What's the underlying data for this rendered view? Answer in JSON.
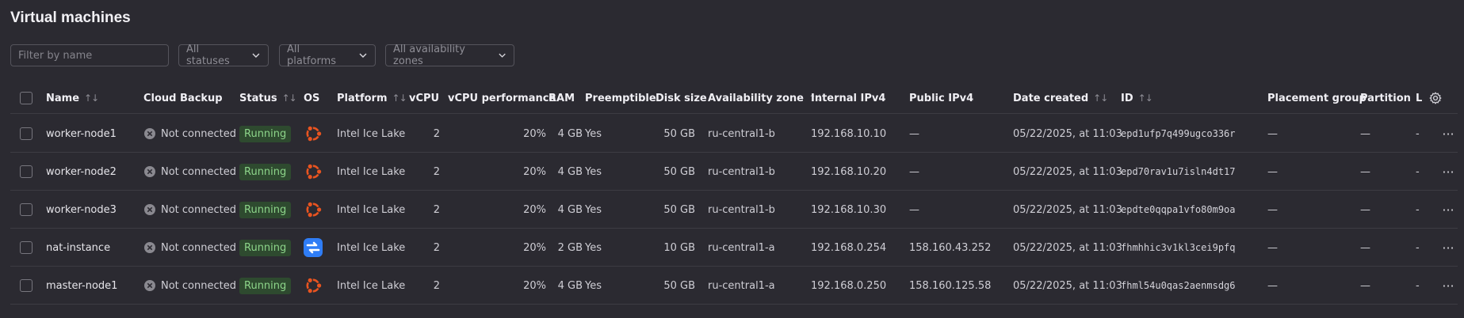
{
  "page": {
    "title": "Virtual machines"
  },
  "filters": {
    "name_placeholder": "Filter by name",
    "statuses": "All statuses",
    "platforms": "All platforms",
    "zones": "All availability zones"
  },
  "columns": {
    "name": "Name",
    "cloud_backup": "Cloud Backup",
    "status": "Status",
    "os": "OS",
    "platform": "Platform",
    "vcpu": "vCPU",
    "vcpu_perf": "vCPU performance",
    "ram": "RAM",
    "preemptible": "Preemptible",
    "disk": "Disk size",
    "zone": "Availability zone",
    "internal_ip": "Internal IPv4",
    "public_ip": "Public IPv4",
    "date_created": "Date created",
    "id": "ID",
    "placement": "Placement group",
    "partition": "Partition",
    "truncated": "L",
    "sort_glyph": "↑↓"
  },
  "rows": [
    {
      "name": "worker-node1",
      "backup": "Not connected",
      "status": "Running",
      "os": "ubuntu-icon",
      "platform": "Intel Ice Lake",
      "vcpu": "2",
      "perf": "20%",
      "ram": "4 GB",
      "preemptible": "Yes",
      "disk": "50 GB",
      "zone": "ru-central1-b",
      "internal_ip": "192.168.10.10",
      "public_ip": "—",
      "date": "05/22/2025, at 11:03",
      "id": "epd1ufp7q499ugco336r",
      "placement": "—",
      "partition": "—",
      "last": "-",
      "more": "···"
    },
    {
      "name": "worker-node2",
      "backup": "Not connected",
      "status": "Running",
      "os": "ubuntu-icon",
      "platform": "Intel Ice Lake",
      "vcpu": "2",
      "perf": "20%",
      "ram": "4 GB",
      "preemptible": "Yes",
      "disk": "50 GB",
      "zone": "ru-central1-b",
      "internal_ip": "192.168.10.20",
      "public_ip": "—",
      "date": "05/22/2025, at 11:03",
      "id": "epd70rav1u7isln4dt17",
      "placement": "—",
      "partition": "—",
      "last": "-",
      "more": "···"
    },
    {
      "name": "worker-node3",
      "backup": "Not connected",
      "status": "Running",
      "os": "ubuntu-icon",
      "platform": "Intel Ice Lake",
      "vcpu": "2",
      "perf": "20%",
      "ram": "4 GB",
      "preemptible": "Yes",
      "disk": "50 GB",
      "zone": "ru-central1-b",
      "internal_ip": "192.168.10.30",
      "public_ip": "—",
      "date": "05/22/2025, at 11:03",
      "id": "epdte0qqpa1vfo80m9oa",
      "placement": "—",
      "partition": "—",
      "last": "-",
      "more": "···"
    },
    {
      "name": "nat-instance",
      "backup": "Not connected",
      "status": "Running",
      "os": "nat-instance-icon",
      "platform": "Intel Ice Lake",
      "vcpu": "2",
      "perf": "20%",
      "ram": "2 GB",
      "preemptible": "Yes",
      "disk": "10 GB",
      "zone": "ru-central1-a",
      "internal_ip": "192.168.0.254",
      "public_ip": "158.160.43.252",
      "date": "05/22/2025, at 11:03",
      "id": "fhmhhic3v1kl3cei9pfq",
      "placement": "—",
      "partition": "—",
      "last": "-",
      "more": "···"
    },
    {
      "name": "master-node1",
      "backup": "Not connected",
      "status": "Running",
      "os": "ubuntu-icon",
      "platform": "Intel Ice Lake",
      "vcpu": "2",
      "perf": "20%",
      "ram": "4 GB",
      "preemptible": "Yes",
      "disk": "50 GB",
      "zone": "ru-central1-a",
      "internal_ip": "192.168.0.250",
      "public_ip": "158.160.125.58",
      "date": "05/22/2025, at 11:03",
      "id": "fhml54u0qas2aenmsdg6",
      "placement": "—",
      "partition": "—",
      "last": "-",
      "more": "···"
    }
  ],
  "colors": {
    "background": "#2b2a31",
    "status_running_bg": "#2e4a2f",
    "status_running_fg": "#8dd58a",
    "ubuntu_orange": "#e95420",
    "nat_blue": "#2f7df6"
  }
}
